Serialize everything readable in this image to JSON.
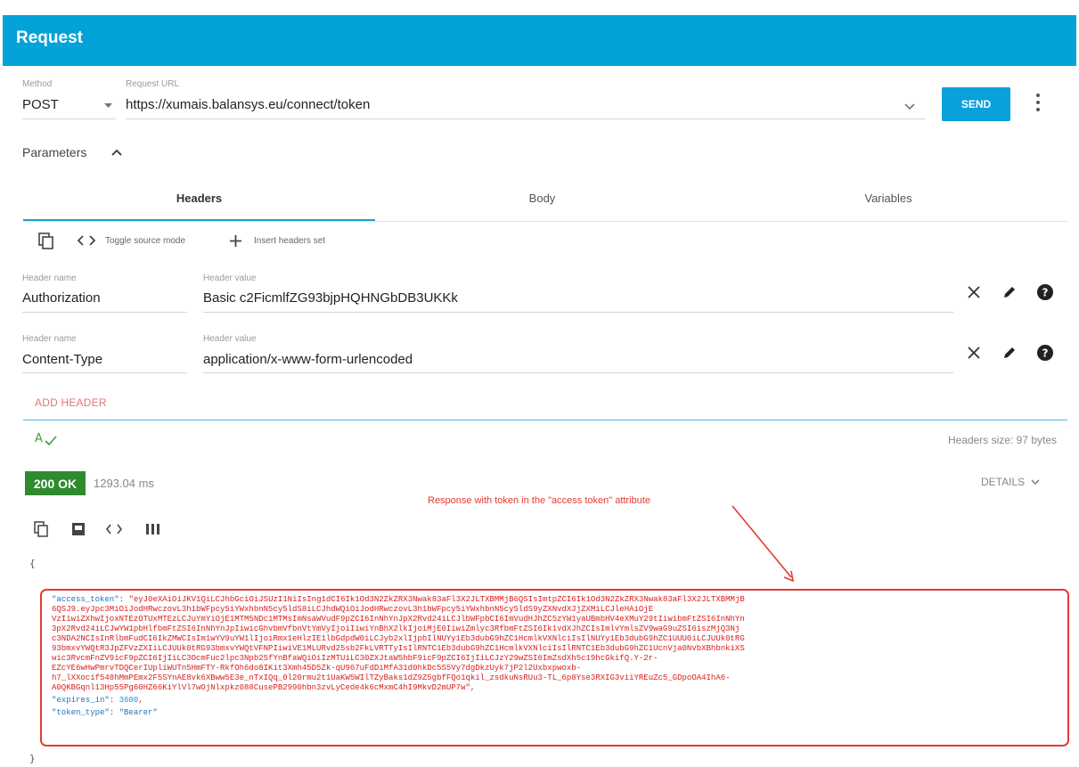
{
  "header": {
    "title": "Request"
  },
  "request": {
    "method_label": "Method",
    "method": "POST",
    "url_label": "Request URL",
    "url": "https://xumais.balansys.eu/connect/token",
    "send_label": "SEND"
  },
  "parameters": {
    "label": "Parameters"
  },
  "tabs": [
    {
      "label": "Headers",
      "active": true
    },
    {
      "label": "Body",
      "active": false
    },
    {
      "label": "Variables",
      "active": false
    }
  ],
  "toolbar": {
    "toggle_source": "Toggle source mode",
    "insert_set": "Insert headers set"
  },
  "headers": [
    {
      "name_label": "Header name",
      "name": "Authorization",
      "value_label": "Header value",
      "value": "Basic c2FicmlfZG93bjpHQHNGbDB3UKKk"
    },
    {
      "name_label": "Header name",
      "name": "Content-Type",
      "value_label": "Header value",
      "value": "application/x-www-form-urlencoded"
    }
  ],
  "add_header_label": "ADD HEADER",
  "headers_size": "Headers size: 97 bytes",
  "response": {
    "status": "200 OK",
    "time": "1293.04 ms",
    "details_label": "DETAILS",
    "annotation": "Response with token in the \"access token\" attribute",
    "open_brace": "{",
    "close_brace": "}",
    "access_token_key": "\"access_token\"",
    "token_lines": [
      "\"eyJ0eXAiOiJKV1QiLCJhbGciOiJSUzI1NiIsIng1dCI6Ik1Od3N2ZkZRX3Nwak83aFl3X2JLTXBMMjB6QSIsImtpZCI6Ik1Od3N2ZkZRX3Nwak83aFl3X2JLTXBMMjB",
      "6QSJ9.eyJpc3MiOiJodHRwczovL3h1bWFpcy5iYWxhbnN5cy5ldS8iLCJhdWQiOiJodHRwczovL3h1bWFpcy5iYWxhbnN5cy5ldS9yZXNvdXJjZXMiLCJleHAiOjE",
      "VzIiwiZXhwIjoxNTEzOTUxMTEzLCJuYmYiOjE1MTM5NDc1MTMsImNsaWVudF9pZCI6InNhYnJpX2Rvd24iLCJlbWFpbCI6ImVudHJhZC5zYW1yaUBmbHV4eXMuY29tIiwibmFtZSI6InNhYn",
      "3pX2Rvd24iLCJwYW1pbHlfbmFtZSI6InNhYnJpIiwicGhvbmVfbnVtYmVyIjoiIiwiYnBhX2lkIjoiMjE0IiwiZmlyc3RfbmFtZSI6Ik1vdXJhZCIsImlvYmlsZV9waG9uZSI6iszMjQ3Nj",
      "c3NDA2NCIsInRlbmFudCI6IkZMWCIsIm1wYV9uYW1lIjoiRmx1eHlzIE1lbGdpdW0iLCJyb2xlIjpbIlNUYy1Eb3dubG9hZC1HcmlkVXNlciIsIlNUYy1Eb3dubG9hZC1UUU0iLCJUUk0tRG",
      "93bmxvYWQtR3JpZFVzZXIiLCJUUk0tRG93bmxvYWQtVFNPIiwiVE1MLURvd25sb2FkLVRTTyIsIlRNTC1Eb3dubG9hZC1HcmlkVXNlciIsIlRNTC1Eb3dubG9hZC1UcnVja0NvbXBhbnkiXS",
      "wic3RvcmFnZV9icF9pZCI6IjIiLC3OcmFuc2lpc3Npb25fYnBfaWQiOiIzMTUiLC30ZXJtaW5hbF9icF9pZCI6IjIiLCJzY29wZSI6ImZsdXh5c19hcGkifQ.Y-2r-",
      "EZcYE6wHwPmrvTDQCerIUpliWUTn5HmFTY-RkfOh6do8IKit3Xmh45D5Zk-qU967uFdDiMfA31d0hkDc5S5Vy7dgDkzUyk7jP2l2Uxbxpwoxb-",
      "h7_lXXocif548hMmPEmx2F5SYnAE8vk6XBww5E3e_nTxIQq_0l20rmu2t1UaKW5WIlTZyBaks1dZ9Z5gbfFQo1qkil_zsdkuNsRUu3-TL_6p8Yse3RXIG3viiYREuZc5_GDpoOA4IhA6-",
      "A0QKBGqnl13Hp55Pg60HZ66KiYlVl7wOjNlxpkz088CusePB2990hbn3zvLyCede4k6cMxmC4hI9MkvD2mUP7w\","
    ],
    "expires_key": "\"expires_in\"",
    "expires_value": "3600",
    "token_type_key": "\"token_type\"",
    "token_type_value": "\"Bearer\""
  }
}
